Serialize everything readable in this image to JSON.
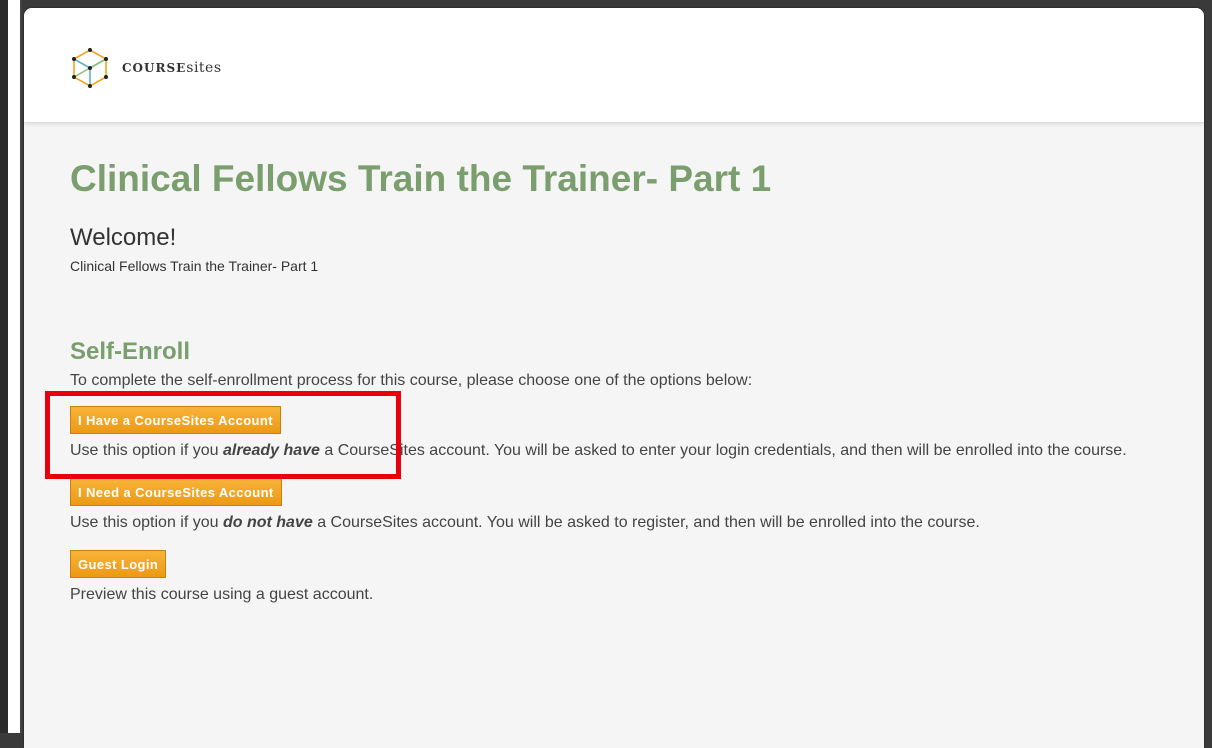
{
  "app": {
    "logo_text_bold": "COURSE",
    "logo_text_light": "sites"
  },
  "page": {
    "title": "Clinical Fellows Train the Trainer- Part 1",
    "welcome_heading": "Welcome!",
    "welcome_subtext": "Clinical Fellows Train the Trainer- Part 1"
  },
  "self_enroll": {
    "heading": "Self-Enroll",
    "intro": "To complete the self-enrollment process for this course, please choose one of the options below:",
    "options": [
      {
        "button_label": "I Have a CourseSites Account",
        "desc_before": "Use this option if you ",
        "desc_emphasis": "already have",
        "desc_after": " a CourseSites account. You will be asked to enter your login credentials, and then will be enrolled into the course."
      },
      {
        "button_label": "I Need a CourseSites Account",
        "desc_before": "Use this option if you ",
        "desc_emphasis": "do not have",
        "desc_after": " a CourseSites account. You will be asked to register, and then will be enrolled into the course."
      },
      {
        "button_label": "Guest Login",
        "desc": "Preview this course using a guest account."
      }
    ]
  },
  "colors": {
    "accent_green": "#7a9e6e",
    "button_orange": "#f3a31d",
    "highlight_red": "#e8000c"
  }
}
